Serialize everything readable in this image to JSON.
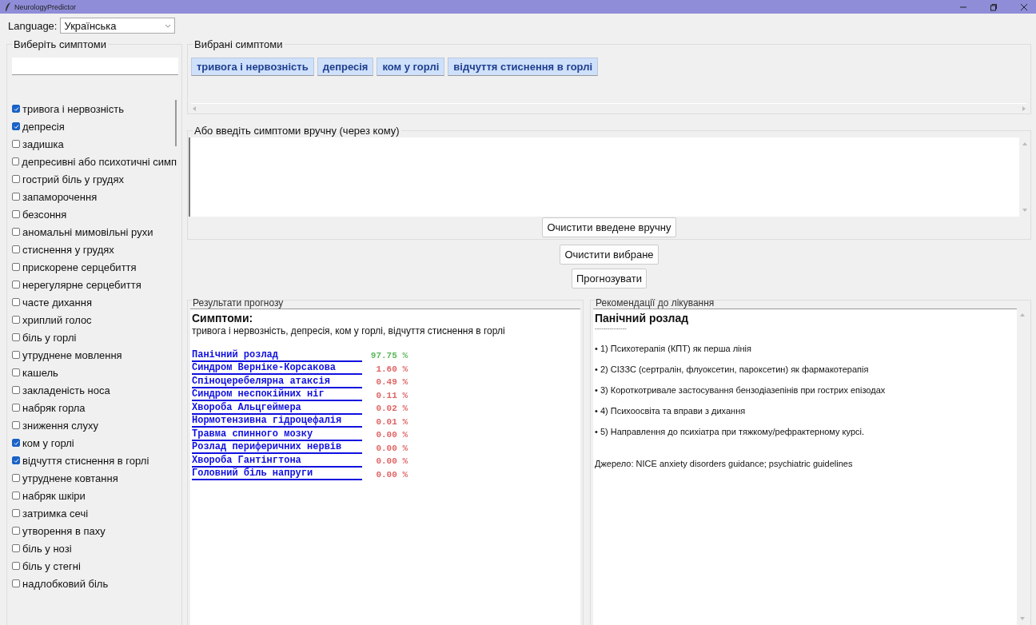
{
  "window": {
    "title": "NeurologyPredictor"
  },
  "language": {
    "label": "Language:",
    "value": "Українська"
  },
  "symptom_picker": {
    "title": "Виберіть симптоми"
  },
  "symptoms": [
    {
      "label": "тривога і нервозність",
      "checked": true
    },
    {
      "label": "депресія",
      "checked": true
    },
    {
      "label": "задишка",
      "checked": false
    },
    {
      "label": "депресивні або психотичні симп",
      "checked": false
    },
    {
      "label": "гострий біль у грудях",
      "checked": false
    },
    {
      "label": "запаморочення",
      "checked": false
    },
    {
      "label": "безсоння",
      "checked": false
    },
    {
      "label": "аномальні мимовільні рухи",
      "checked": false
    },
    {
      "label": "стиснення у грудях",
      "checked": false
    },
    {
      "label": "прискорене серцебиття",
      "checked": false
    },
    {
      "label": "нерегулярне серцебиття",
      "checked": false
    },
    {
      "label": "часте дихання",
      "checked": false
    },
    {
      "label": "хриплий голос",
      "checked": false
    },
    {
      "label": "біль у горлі",
      "checked": false
    },
    {
      "label": "утруднене мовлення",
      "checked": false
    },
    {
      "label": "кашель",
      "checked": false
    },
    {
      "label": "закладеність носа",
      "checked": false
    },
    {
      "label": "набряк горла",
      "checked": false
    },
    {
      "label": "зниження слуху",
      "checked": false
    },
    {
      "label": "ком у горлі",
      "checked": true
    },
    {
      "label": "відчуття стиснення в горлі",
      "checked": true
    },
    {
      "label": "утруднене ковтання",
      "checked": false
    },
    {
      "label": "набряк шкіри",
      "checked": false
    },
    {
      "label": "затримка сечі",
      "checked": false
    },
    {
      "label": "утворення в паху",
      "checked": false
    },
    {
      "label": "біль у нозі",
      "checked": false
    },
    {
      "label": "біль у стегні",
      "checked": false
    },
    {
      "label": "надлобковий біль",
      "checked": false
    }
  ],
  "selected_symptoms": {
    "title": "Вибрані симптоми",
    "chips": [
      "тривога і нервозність",
      "депресія",
      "ком у горлі",
      "відчуття стиснення в горлі"
    ]
  },
  "manual_entry": {
    "title": "Або введіть симптоми вручну (через кому)",
    "clear_button": "Очистити введене вручну"
  },
  "buttons": [
    "Очистити вибране",
    "Прогнозувати"
  ],
  "results": {
    "title": "Результати прогнозу",
    "heading": "Симптоми:",
    "symptoms_line": "тривога і нервозність, депресія, ком у горлі, відчуття стиснення в горлі",
    "predictions": [
      {
        "disease": "Панічний розлад",
        "probability": "97.75 %",
        "color": "#5cb85c"
      },
      {
        "disease": "Синдром Верніке-Корсакова",
        "probability": "1.60 %",
        "color": "#e06666"
      },
      {
        "disease": "Спіноцеребелярна атаксія",
        "probability": "0.49 %",
        "color": "#e06666"
      },
      {
        "disease": "Синдром неспокійних ніг",
        "probability": "0.11 %",
        "color": "#e06666"
      },
      {
        "disease": "Хвороба Альцгеймера",
        "probability": "0.02 %",
        "color": "#e06666"
      },
      {
        "disease": "Нормотензивна гідроцефалія",
        "probability": "0.01 %",
        "color": "#e06666"
      },
      {
        "disease": "Травма спинного мозку",
        "probability": "0.00 %",
        "color": "#e06666"
      },
      {
        "disease": "Розлад периферичних нервів",
        "probability": "0.00 %",
        "color": "#e06666"
      },
      {
        "disease": "Хвороба Гантінгтона",
        "probability": "0.00 %",
        "color": "#e06666"
      },
      {
        "disease": "Головний біль напруги",
        "probability": "0.00 %",
        "color": "#e06666"
      }
    ]
  },
  "recommendations": {
    "title": "Рекомендації до лікування",
    "heading": "Панічний розлад",
    "separator": "---------------",
    "items": [
      "• 1) Психотерапія (КПТ) як перша лінія",
      "• 2) СІЗЗС (сертралін, флуоксетин, пароксетин) як фармакотерапія",
      "• 3) Короткотривале застосування бензодіазепінів при гострих епізодах",
      "• 4) Психоосвіта та вправи з дихання",
      "• 5) Направлення до психіатра при тяжкому/рефрактерному курсі."
    ],
    "source": "Джерело: NICE anxiety disorders guidance; psychiatric guidelines"
  }
}
